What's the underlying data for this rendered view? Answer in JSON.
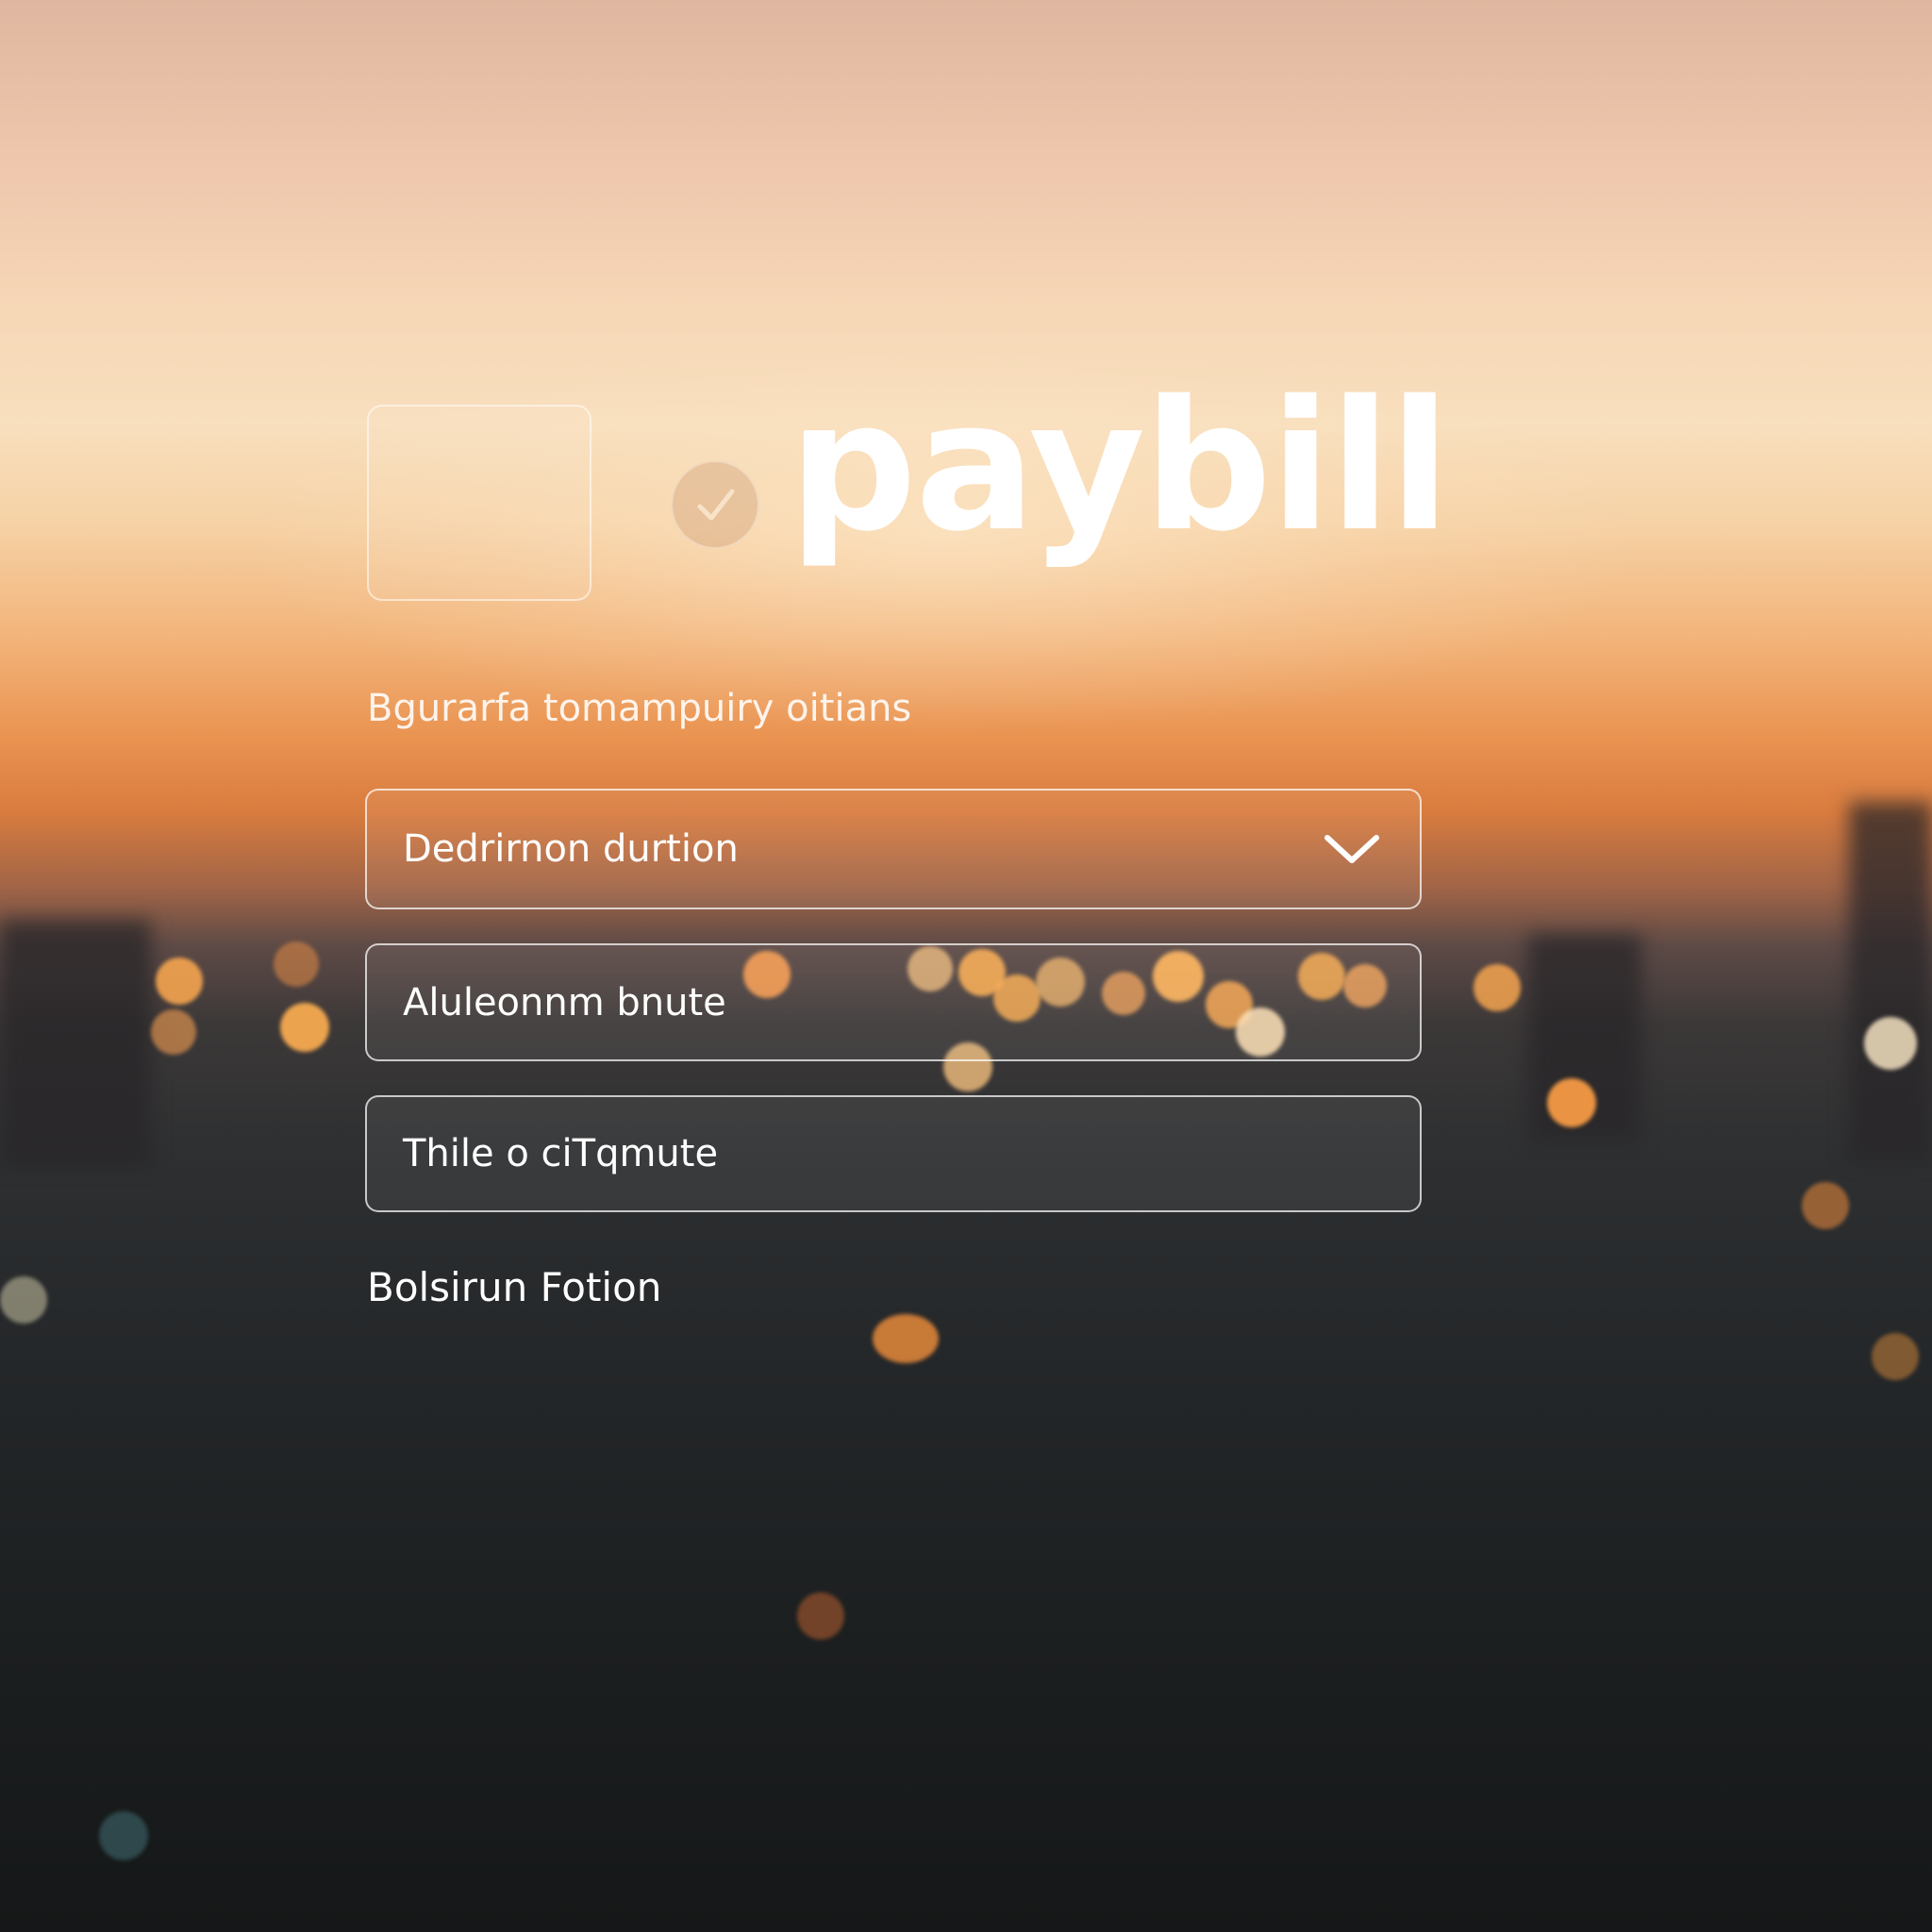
{
  "brand": {
    "name": "paybill",
    "badge_icon": "check-badge-icon"
  },
  "form": {
    "section_label": "Bgurarfa tomampuiry oitians",
    "select": {
      "value": "Dedrirnon durtion",
      "icon": "chevron-down-icon"
    },
    "field_2": {
      "value": "Aluleonnm bnute"
    },
    "field_3": {
      "value": "Thile o ciTqmute"
    },
    "footer_label": "Bolsirun Fotion"
  },
  "colors": {
    "sky_top": "#dfb7a0",
    "sunset_orange": "#ea9452",
    "city_dark": "#1c1f20",
    "text": "#ffffff",
    "field_border": "rgba(255,255,255,0.72)"
  }
}
